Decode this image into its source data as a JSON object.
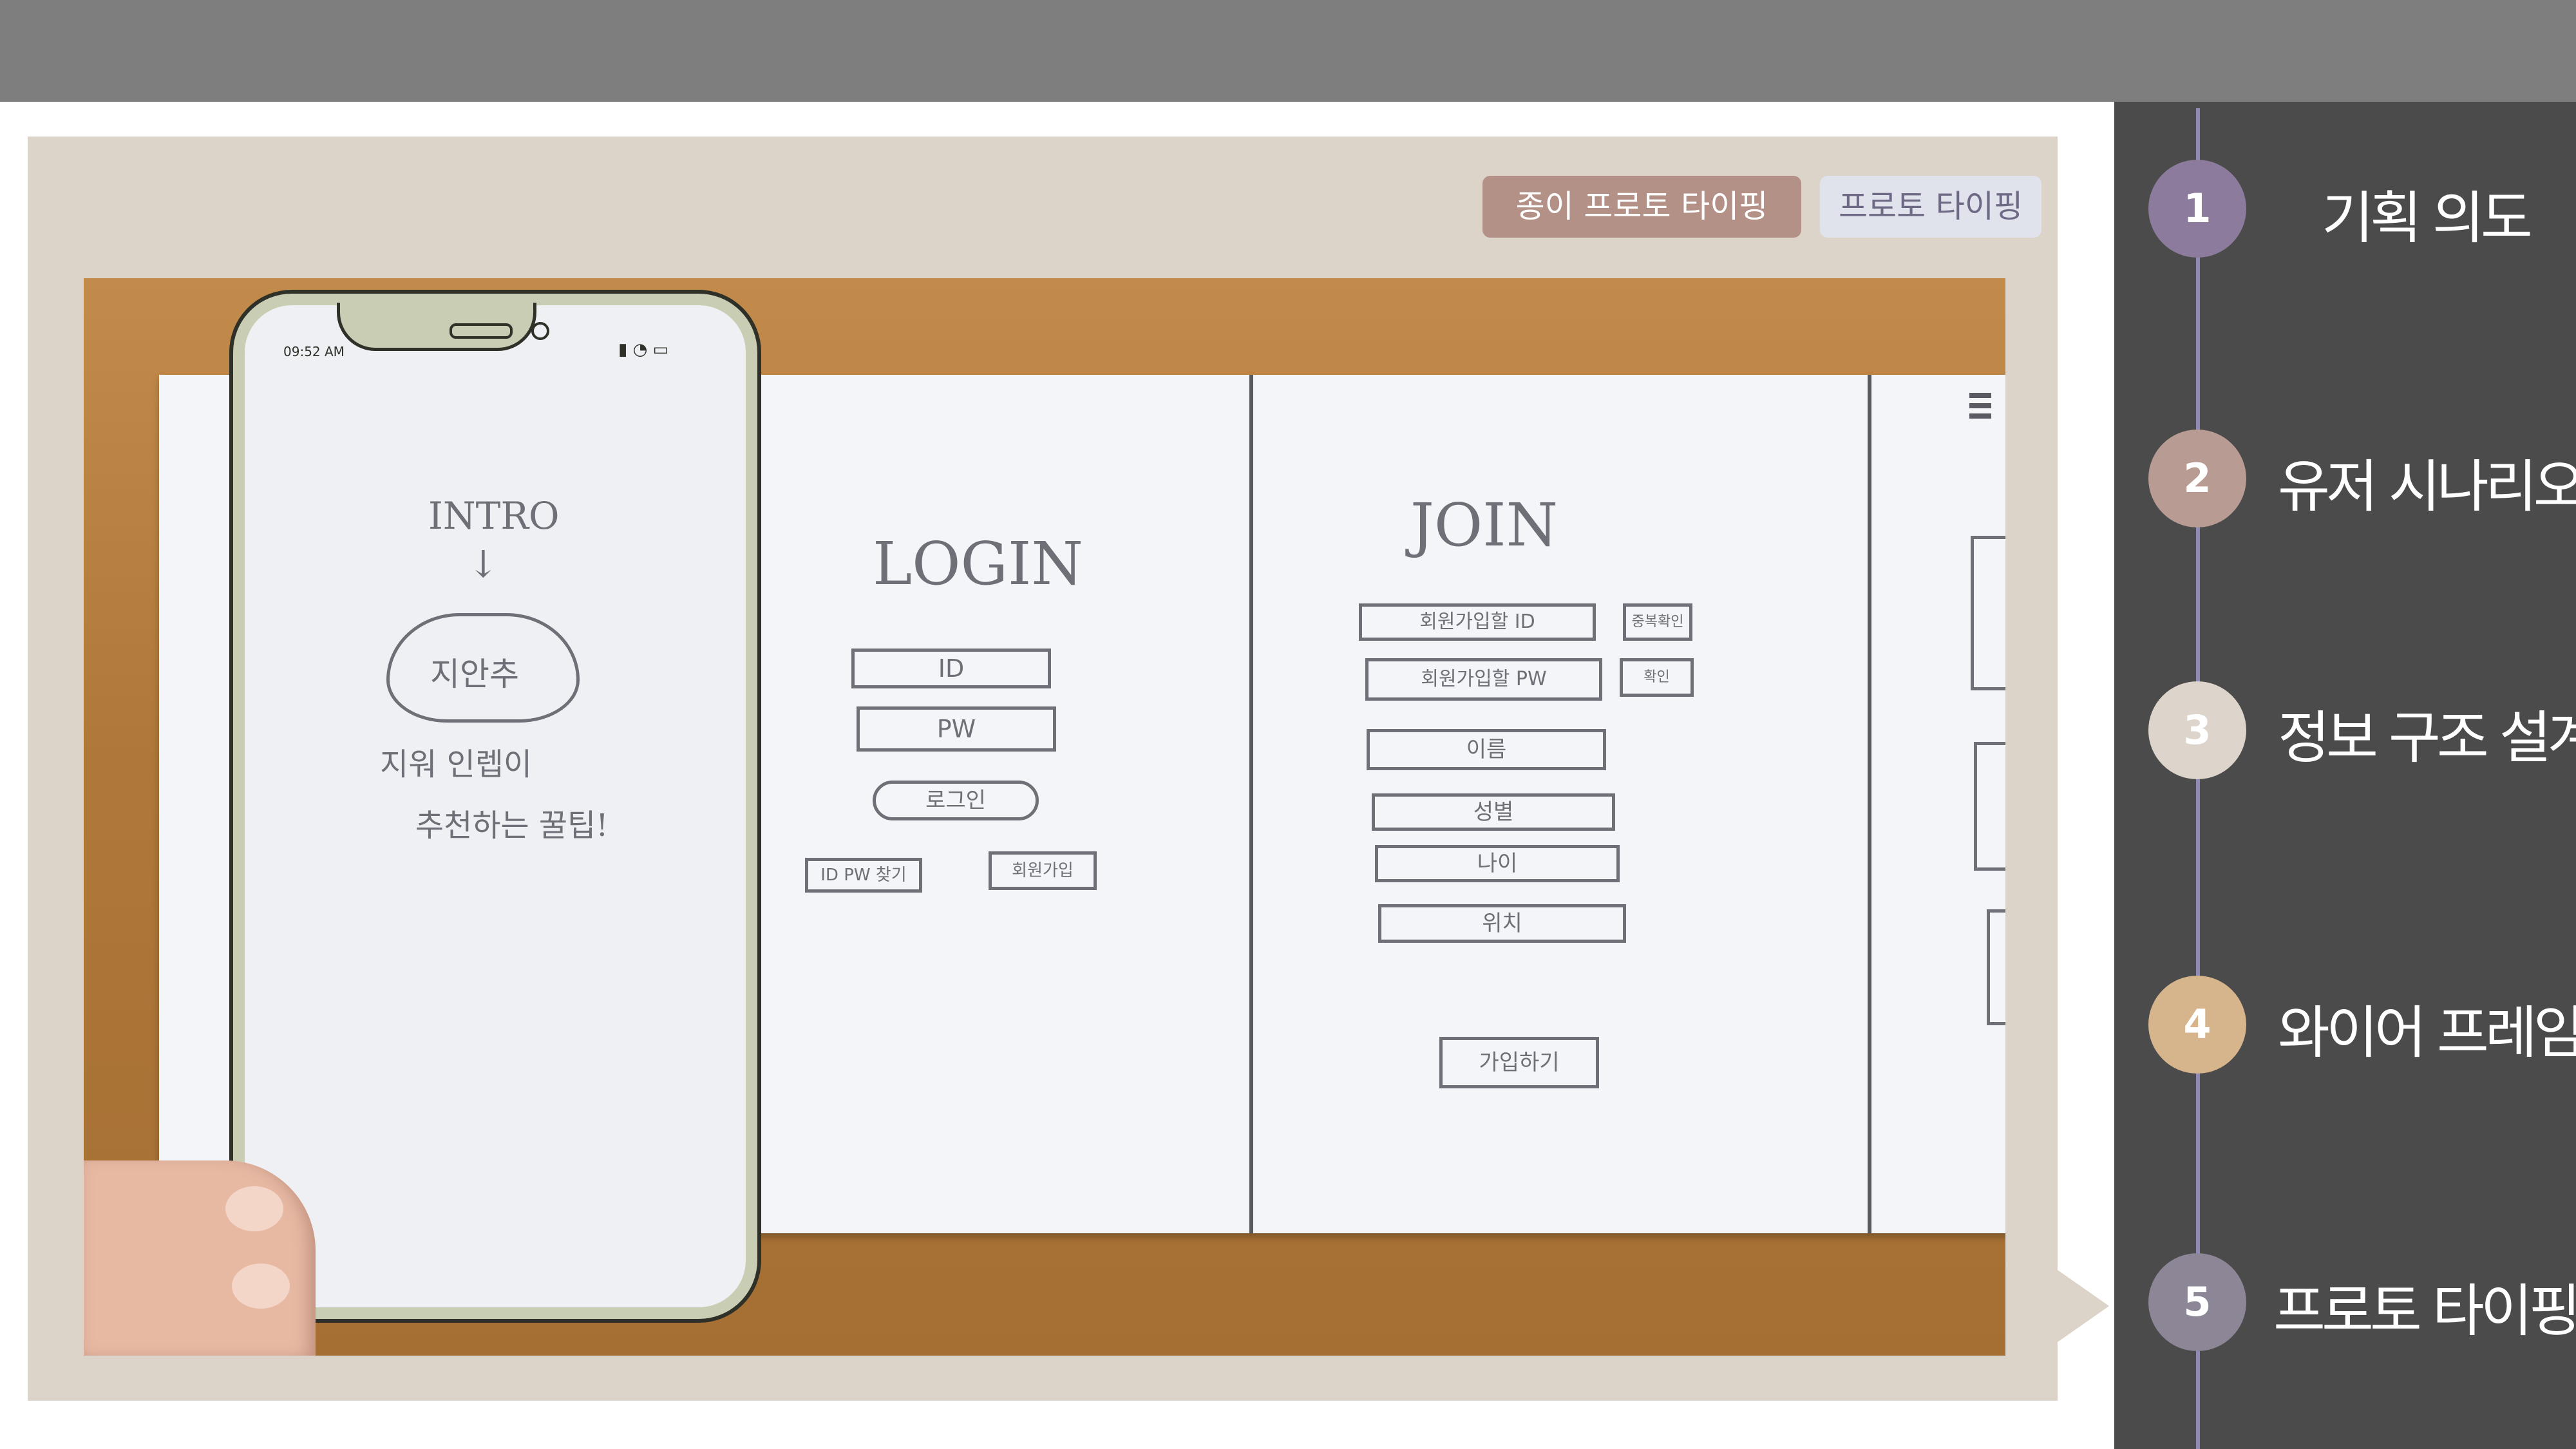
{
  "tags": {
    "paper_prototyping": "종이 프로토 타이핑",
    "prototyping": "프로토 타이핑"
  },
  "sketch": {
    "phone_time": "09:52 AM",
    "intro_title": "INTRO",
    "intro_arrow": "↓",
    "intro_cloud": "지안추",
    "intro_line1": "지워 인렙이",
    "intro_line2": "추천하는 꿀팁!",
    "login_title": "LOGIN",
    "login_id": "ID",
    "login_pw": "PW",
    "login_button": "로그인",
    "find_idpw": "ID PW 찾기",
    "signup_link": "회원가입",
    "join_title": "JOIN",
    "join_id": "회원가입할   ID",
    "join_id_check": "중복확인",
    "join_pw": "회원가입할   PW",
    "join_pw_check": "확인",
    "join_name": "이름",
    "join_gender": "성별",
    "join_age": "나이",
    "join_location": "위치",
    "join_submit": "가입하기"
  },
  "nav": {
    "active_step": 5,
    "steps": [
      {
        "number": "1",
        "label": "기획 의도",
        "color": "#8c7b9c"
      },
      {
        "number": "2",
        "label": "유저 시나리오",
        "color": "#b89b92"
      },
      {
        "number": "3",
        "label": "정보 구조 설계",
        "color": "#ddd5cb"
      },
      {
        "number": "4",
        "label": "와이어 프레임",
        "color": "#d6b58d"
      },
      {
        "number": "5",
        "label": "프로토 타이핑",
        "color": "#8c8696"
      }
    ]
  },
  "colors": {
    "topbar": "#7e7e7e",
    "panel": "#dcd3c9",
    "sidebar": "#4b4b4b",
    "timeline": "#9088b5"
  }
}
